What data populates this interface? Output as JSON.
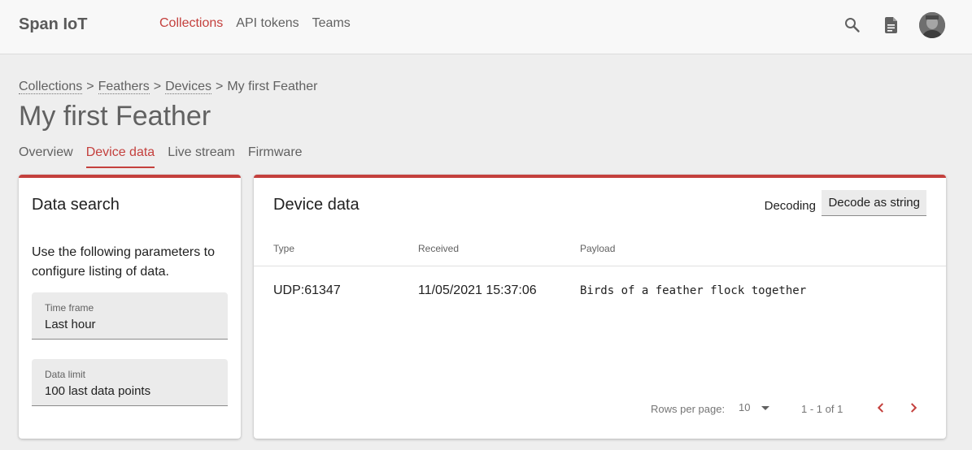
{
  "app": {
    "title": "Span IoT"
  },
  "nav": {
    "items": [
      {
        "label": "Collections",
        "active": true
      },
      {
        "label": "API tokens",
        "active": false
      },
      {
        "label": "Teams",
        "active": false
      }
    ]
  },
  "header_icons": [
    "search-icon",
    "document-icon",
    "avatar"
  ],
  "breadcrumb": {
    "items": [
      "Collections",
      "Feathers",
      "Devices"
    ],
    "separator": ">",
    "current": "My first Feather"
  },
  "page": {
    "title": "My first Feather"
  },
  "tabs": [
    {
      "label": "Overview",
      "active": false
    },
    {
      "label": "Device data",
      "active": true
    },
    {
      "label": "Live stream",
      "active": false
    },
    {
      "label": "Firmware",
      "active": false
    }
  ],
  "search_panel": {
    "title": "Data search",
    "description": "Use the following parameters to configure listing of data.",
    "time_frame": {
      "label": "Time frame",
      "value": "Last hour"
    },
    "data_limit": {
      "label": "Data limit",
      "value": "100 last data points"
    }
  },
  "data_panel": {
    "title": "Device data",
    "decoding_label": "Decoding",
    "decode_button": "Decode as string",
    "columns": [
      "Type",
      "Received",
      "Payload"
    ],
    "rows": [
      {
        "type": "UDP:61347",
        "received": "11/05/2021 15:37:06",
        "payload": "Birds of a feather flock together"
      }
    ],
    "pagination": {
      "rows_per_page_label": "Rows per page:",
      "rows_per_page": "10",
      "range": "1 - 1 of 1"
    }
  },
  "colors": {
    "accent": "#c4403d",
    "background": "#eeeeee",
    "card": "#ffffff",
    "text": "#212121",
    "muted": "#616161"
  }
}
